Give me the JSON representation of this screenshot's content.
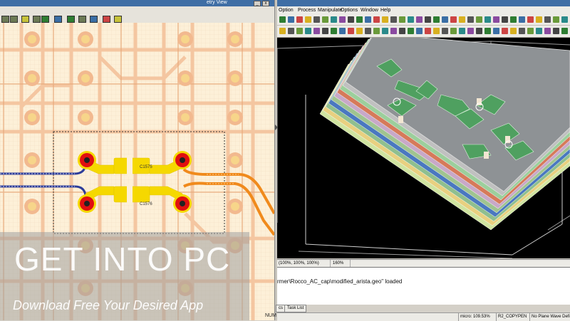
{
  "left_window": {
    "title": "etry View",
    "components": [
      {
        "ref": "C1575"
      },
      {
        "ref": "C1576"
      }
    ],
    "status_indicator": "NUM"
  },
  "right_window": {
    "menu": [
      "Option",
      "Process",
      "Manipulate",
      "Options",
      "Window",
      "Help"
    ],
    "status_cells": [
      "(100%, 100%, 100%)",
      "160%"
    ],
    "console_text": "rmer\\Rocco_AC_cap\\modified_arista.geo\" loaded",
    "console_tabs": [
      "cs",
      "Task List"
    ],
    "bottom_status": [
      "micro: 109.53%",
      "R2_COPYPEN",
      "No Plane Wave Defined"
    ]
  },
  "watermark": {
    "title": "GET INTO PC",
    "subtitle": "Download Free Your Desired App"
  },
  "colors": {
    "pcb_background": "#fdf0d8",
    "trace_peach": "#f6c6a0",
    "trace_blue": "#2d3d9a",
    "trace_orange": "#f08a1c",
    "pad_red": "#e01010",
    "pad_yellow": "#f5d800",
    "viewport_background": "#000000",
    "board_top": "#8e9295"
  },
  "icons": [
    "window-minimize-icon",
    "window-close-icon",
    "toolbar-icons",
    "splitter-arrow-icon"
  ]
}
